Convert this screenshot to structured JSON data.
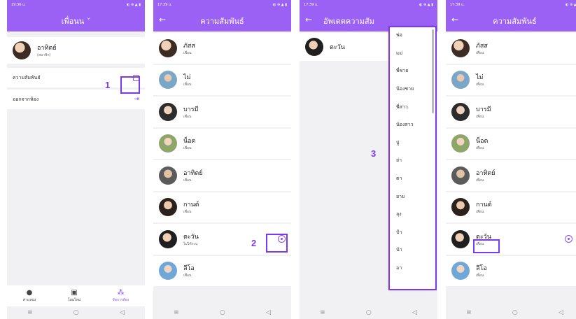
{
  "accent": "#9b61f5",
  "highlight": "#7c3aed",
  "status": {
    "p1": "19:36 u.",
    "p2": "17:39 u.",
    "p3": "17:39 u.",
    "p4": "17:39 u."
  },
  "screen1": {
    "title": "เพื่อนน ˇ",
    "user": {
      "name": "อาทิตย์",
      "sub": "(สมาชิก)"
    },
    "relation_label": "ความสัมพันธ์",
    "leave_label": "ออกจากห้อง",
    "nav": [
      {
        "icon": "location-pin-icon",
        "glyph": "●",
        "label": "ค่าแหน่ง"
      },
      {
        "icon": "gallery-icon",
        "glyph": "▣",
        "label": "โหมไหม่"
      },
      {
        "icon": "manage-room-icon",
        "glyph": "⁂",
        "label": "จัดการห้อง"
      }
    ]
  },
  "screen2": {
    "title": "ความสัมพันธ์",
    "friends": [
      {
        "name": "ภัสส",
        "sub": "เพื่อน"
      },
      {
        "name": "ไม่",
        "sub": "เพื่อน"
      },
      {
        "name": "บารมี",
        "sub": "เพื่อน"
      },
      {
        "name": "น็อต",
        "sub": "เพื่อน"
      },
      {
        "name": "อาทิตย์",
        "sub": "เพื่อน"
      },
      {
        "name": "กานต์",
        "sub": "เพื่อน"
      },
      {
        "name": "ตะวัน",
        "sub": "ไม่ได้ระบุ"
      },
      {
        "name": "ลีโอ",
        "sub": "เพื่อน"
      }
    ]
  },
  "screen3": {
    "title": "อัพเดตความสัม",
    "person": "ตะวัน",
    "options": [
      "พ่อ",
      "แม่",
      "พี่ชาย",
      "น้องชาย",
      "พี่สาว",
      "น้องสาว",
      "ปู่",
      "ย่า",
      "ตา",
      "ยาย",
      "ลุง",
      "ป้า",
      "น้า",
      "อา"
    ]
  },
  "screen4": {
    "title": "ความสัมพันธ์",
    "friends": [
      {
        "name": "ภัสส",
        "sub": "เพื่อน"
      },
      {
        "name": "ไม่",
        "sub": "เพื่อน"
      },
      {
        "name": "บารมี",
        "sub": "เพื่อน"
      },
      {
        "name": "น็อต",
        "sub": "เพื่อน"
      },
      {
        "name": "อาทิตย์",
        "sub": "เพื่อน"
      },
      {
        "name": "กานต์",
        "sub": "เพื่อน"
      },
      {
        "name": "ตะวัน",
        "sub": "เพื่อน"
      },
      {
        "name": "ลีโอ",
        "sub": "เพื่อน"
      }
    ]
  },
  "callouts": {
    "one": "1",
    "two": "2",
    "three": "3"
  },
  "sysnav": {
    "menu": "≡",
    "home": "○",
    "back": "◁"
  }
}
